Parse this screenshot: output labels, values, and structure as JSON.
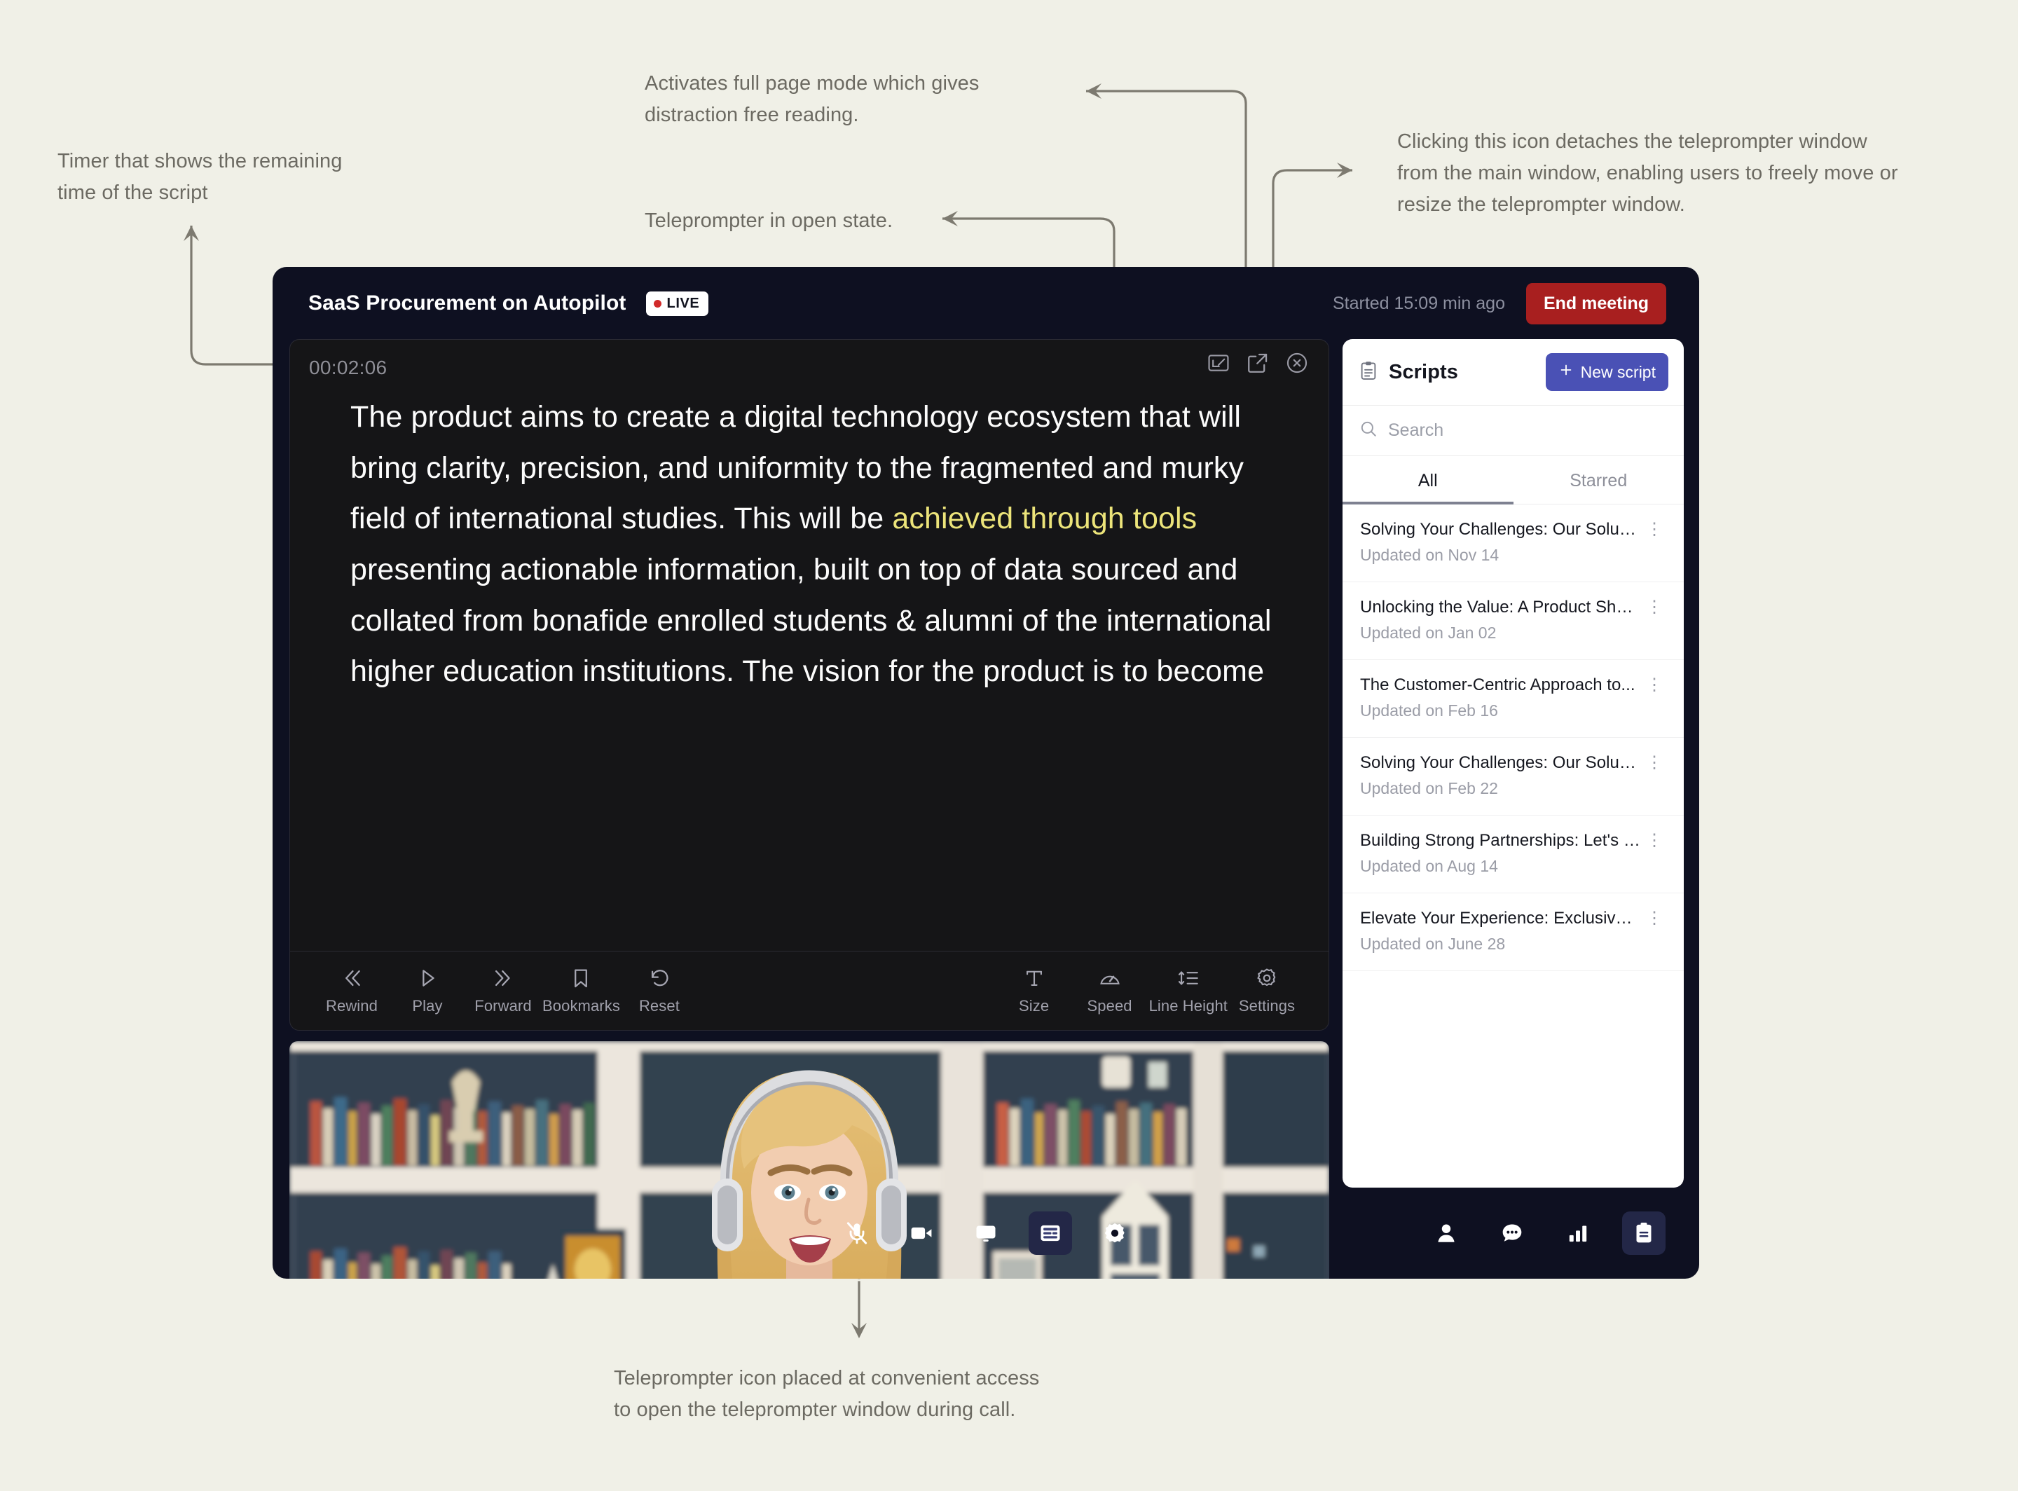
{
  "annotations": [
    {
      "id": "timer",
      "text": "Timer that shows the remaining\ntime of the script"
    },
    {
      "id": "fullpage",
      "text": "Activates full page mode which gives\ndistraction free reading."
    },
    {
      "id": "open-state",
      "text": "Teleprompter in open state."
    },
    {
      "id": "detach",
      "text": "Clicking this icon detaches the teleprompter window\nfrom the main window, enabling users to freely move or\nresize the teleprompter window."
    },
    {
      "id": "bottom-icon",
      "text": "Teleprompter icon placed at convenient access\nto open the teleprompter window during call."
    }
  ],
  "window": {
    "title": "SaaS Procurement on Autopilot",
    "live_label": "LIVE",
    "started_text": "Started 15:09 min ago",
    "end_meeting_label": "End meeting"
  },
  "teleprompter": {
    "timer": "00:02:06",
    "script_before": "The product aims to create a digital technology ecosystem that will bring clarity, precision, and uniformity to the fragmented and murky field of international studies. This will be ",
    "script_highlight": "achieved through tools",
    "script_after": " presenting actionable information, built on top of data sourced and collated from bonafide enrolled students & alumni of the international higher education institutions. The vision for the product is to become",
    "window_icons": [
      {
        "name": "fullscreen-icon",
        "label": "Full page mode"
      },
      {
        "name": "detach-icon",
        "label": "Detach window"
      },
      {
        "name": "close-icon",
        "label": "Close"
      }
    ],
    "tools_left": [
      {
        "icon": "rewind-icon",
        "label": "Rewind"
      },
      {
        "icon": "play-icon",
        "label": "Play"
      },
      {
        "icon": "forward-icon",
        "label": "Forward"
      },
      {
        "icon": "bookmark-icon",
        "label": "Bookmarks"
      },
      {
        "icon": "reset-icon",
        "label": "Reset"
      }
    ],
    "tools_right": [
      {
        "icon": "text-size-icon",
        "label": "Size"
      },
      {
        "icon": "speed-gauge-icon",
        "label": "Speed"
      },
      {
        "icon": "line-height-icon",
        "label": "Line Height"
      },
      {
        "icon": "gear-icon",
        "label": "Settings"
      }
    ]
  },
  "scripts": {
    "panel_title": "Scripts",
    "new_script_label": "New script",
    "search_placeholder": "Search",
    "search_value": "",
    "tabs": [
      {
        "label": "All",
        "active": true
      },
      {
        "label": "Starred",
        "active": false
      }
    ],
    "items": [
      {
        "title": "Solving Your Challenges: Our Solutions",
        "subtitle": "Updated on Nov 14"
      },
      {
        "title": "Unlocking the Value: A Product Showcase",
        "subtitle": "Updated on Jan 02"
      },
      {
        "title": "The Customer-Centric Approach to...",
        "subtitle": "Updated on Feb 16"
      },
      {
        "title": "Solving Your Challenges: Our Solutions",
        "subtitle": "Updated on Feb 22"
      },
      {
        "title": "Building Strong Partnerships: Let's Col...",
        "subtitle": "Updated on Aug 14"
      },
      {
        "title": "Elevate Your Experience: Exclusive Be...",
        "subtitle": "Updated on June 28"
      }
    ],
    "menu_glyph": "⋮"
  },
  "bottom_bar": {
    "center": [
      {
        "icon": "mic-muted-icon",
        "active": false
      },
      {
        "icon": "camera-icon",
        "active": false
      },
      {
        "icon": "screen-share-icon",
        "active": false
      },
      {
        "icon": "teleprompter-icon",
        "active": true
      },
      {
        "icon": "gear-icon",
        "active": false
      }
    ],
    "right": [
      {
        "icon": "participants-icon",
        "active": false
      },
      {
        "icon": "chat-icon",
        "active": false
      },
      {
        "icon": "poll-icon",
        "active": false
      },
      {
        "icon": "scripts-clipboard-icon",
        "active": true
      }
    ]
  },
  "colors": {
    "page_bg": "#f0f0e7",
    "window_bg": "#0e1021",
    "teleprompter_bg": "#151517",
    "accent_purple": "#4a51b5",
    "end_meeting_red": "#a81f1f",
    "highlight_yellow": "#ece47a",
    "annotation_text": "#6c6a62"
  }
}
